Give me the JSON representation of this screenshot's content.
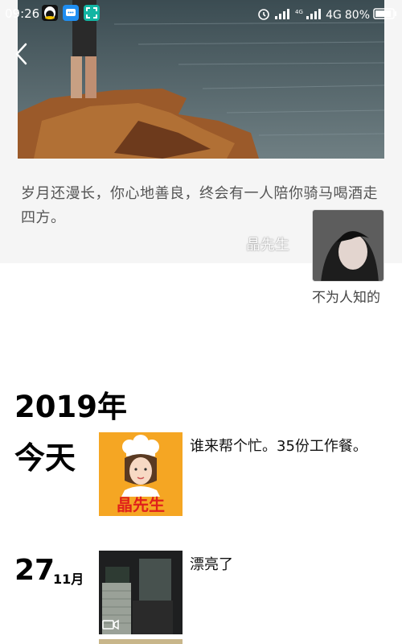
{
  "status_bar": {
    "time": "09:26",
    "network": "4G",
    "battery": "80%"
  },
  "cover": {
    "quote": "岁月还漫长，你心地善良，终会有一人陪你骑马喝酒走四方。",
    "author_watermark": "晶先生"
  },
  "profile": {
    "nickname": "不为人知的"
  },
  "timeline": {
    "year_label": "2019年",
    "posts": [
      {
        "date_label": "今天",
        "text": "谁来帮个忙。35份工作餐。",
        "thumb_caption": "晶先生"
      },
      {
        "day": "27",
        "month": "11月",
        "text": "漂亮了"
      }
    ]
  },
  "colors": {
    "thumb_orange": "#f5a623",
    "thumb_caption_red": "#e0201b",
    "quote_grey": "#555555"
  }
}
